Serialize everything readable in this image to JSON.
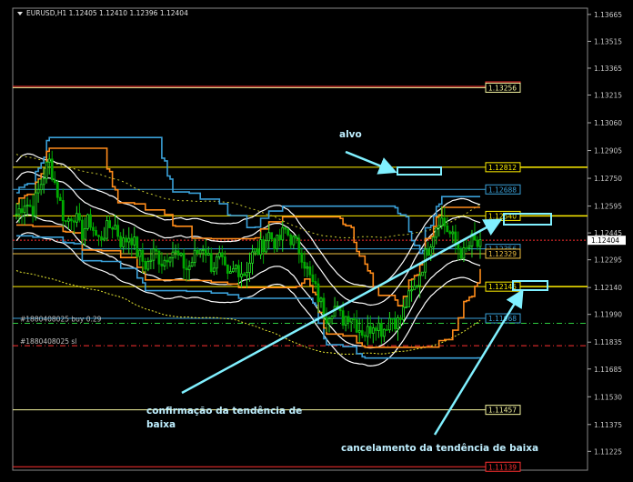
{
  "window": {
    "title": "EURUSD,H1  1.12405 1.12410 1.12396 1.12404",
    "menu_icon": "triangle-down-icon"
  },
  "chart_data": {
    "type": "candlestick",
    "symbol": "EURUSD",
    "timeframe": "H1",
    "ohlc": {
      "open": 1.12405,
      "high": 1.1241,
      "low": 1.12396,
      "close": 1.12404
    },
    "current_price": "1.12404",
    "ylim": [
      1.1112,
      1.137
    ],
    "y_ticks": [
      "1.13665",
      "1.13515",
      "1.13365",
      "1.13215",
      "1.13060",
      "1.12905",
      "1.12750",
      "1.12595",
      "1.12445",
      "1.12295",
      "1.12140",
      "1.11990",
      "1.11835",
      "1.11685",
      "1.11530",
      "1.11375",
      "1.11225"
    ],
    "price_lines": [
      {
        "label": "1.13263",
        "price": 1.13263,
        "color": "#ff3030"
      },
      {
        "label": "1.13256",
        "price": 1.13256,
        "color": "#f5f5a0"
      },
      {
        "label": "1.12812",
        "price": 1.12812,
        "color": "#ffee00"
      },
      {
        "label": "1.12688",
        "price": 1.12688,
        "color": "#3aa0d8"
      },
      {
        "label": "1.12540",
        "price": 1.1254,
        "color": "#ffee00"
      },
      {
        "label": "1.12356",
        "price": 1.12356,
        "color": "#3aa0d8"
      },
      {
        "label": "1.12329",
        "price": 1.12329,
        "color": "#f0c040"
      },
      {
        "label": "1.12145",
        "price": 1.12145,
        "color": "#ffee00"
      },
      {
        "label": "1.11968",
        "price": 1.11968,
        "color": "#3aa0d8"
      },
      {
        "label": "1.11457",
        "price": 1.11457,
        "color": "#f5f5a0"
      },
      {
        "label": "1.11139",
        "price": 1.11139,
        "color": "#ff3030"
      }
    ],
    "orders": [
      {
        "label": "#1880408025 buy 0.29",
        "price": 1.1194,
        "color": "#2ecc40"
      },
      {
        "label": "#1880408025 sl",
        "price": 1.11815,
        "color": "#ff3030"
      }
    ],
    "annotations": [
      {
        "text": "alvo"
      },
      {
        "text": "confirmação da tendência de baixa"
      },
      {
        "text": "cancelamento da tendência de baixa"
      }
    ],
    "candle_close_path": [
      1.1255,
      1.1262,
      1.1258,
      1.1272,
      1.1285,
      1.1268,
      1.125,
      1.1256,
      1.1244,
      1.1252,
      1.124,
      1.1246,
      1.125,
      1.1238,
      1.1244,
      1.1232,
      1.1226,
      1.1234,
      1.1228,
      1.1236,
      1.123,
      1.1224,
      1.1232,
      1.1238,
      1.1226,
      1.123,
      1.1218,
      1.1226,
      1.1222,
      1.1232,
      1.1236,
      1.1244,
      1.1238,
      1.1246,
      1.124,
      1.1234,
      1.122,
      1.121,
      1.1198,
      1.1204,
      1.1196,
      1.12,
      1.1192,
      1.1188,
      1.1196,
      1.119,
      1.1198,
      1.1194,
      1.1206,
      1.1214,
      1.1228,
      1.1242,
      1.1254,
      1.1246,
      1.1238,
      1.1232,
      1.124,
      1.1236
    ],
    "colors": {
      "bull": "#22dd22",
      "bear": "#22dd22",
      "band": "#ffffff",
      "channel": "#3aa0d8",
      "channel2": "#ff8c1a",
      "ma_dotted": "#e8e830",
      "arrow": "#80f0ff"
    },
    "grid": false
  }
}
